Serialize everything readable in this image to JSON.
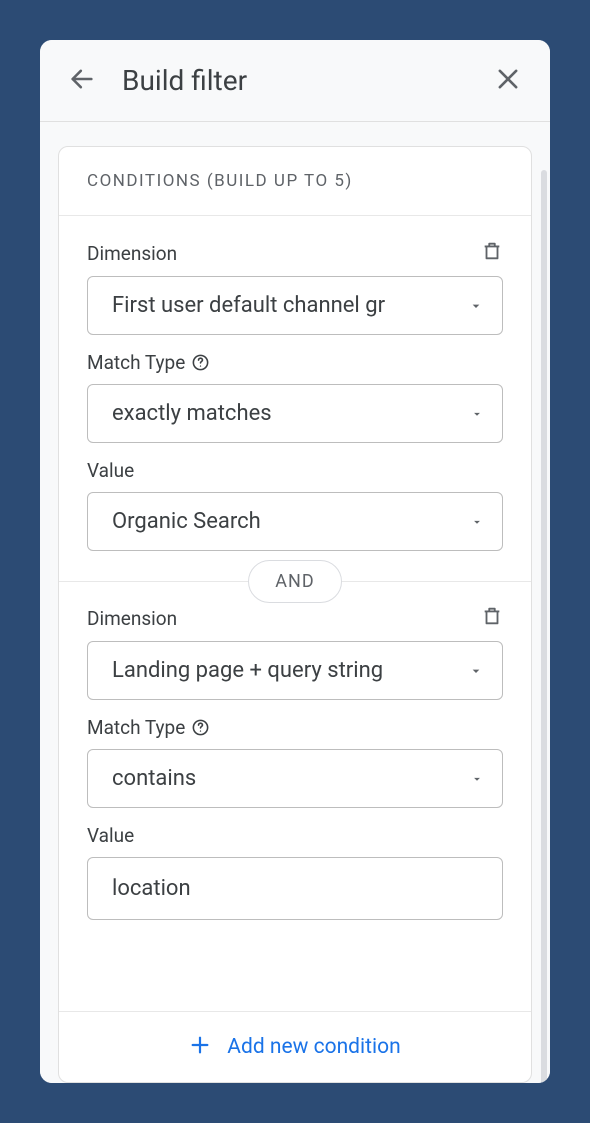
{
  "header": {
    "title": "Build filter"
  },
  "card": {
    "title": "CONDITIONS (BUILD UP TO 5)"
  },
  "labels": {
    "dimension": "Dimension",
    "matchType": "Match Type",
    "value": "Value"
  },
  "conditions": [
    {
      "dimension": "First user default channel gr",
      "matchType": "exactly matches",
      "value": "Organic Search",
      "valueIsSelect": true
    },
    {
      "dimension": "Landing page + query string",
      "matchType": "contains",
      "value": "location",
      "valueIsSelect": false
    }
  ],
  "connector": "AND",
  "footer": {
    "addLabel": "Add new condition"
  }
}
